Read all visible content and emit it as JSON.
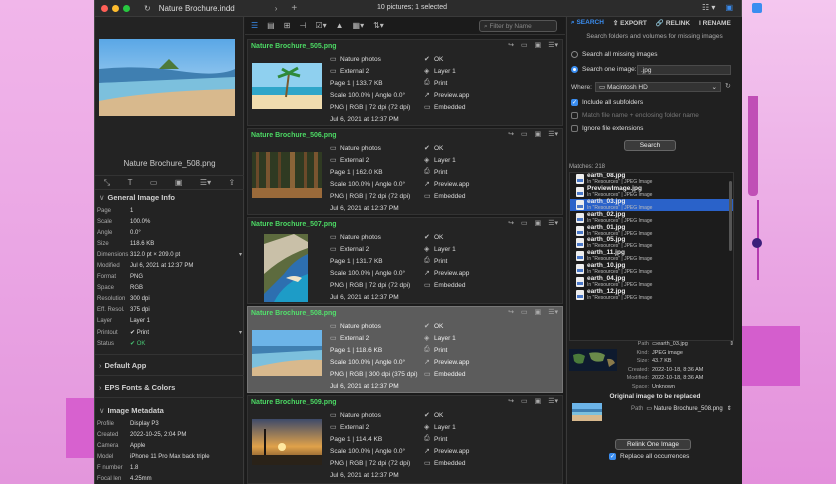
{
  "window": {
    "doc_title": "Nature Brochure.indd",
    "status": "10 pictures; 1 selected"
  },
  "preview": {
    "filename": "Nature Brochure_508.png"
  },
  "general_info": {
    "heading": "General Image Info",
    "rows": [
      {
        "k": "Page",
        "v": "1"
      },
      {
        "k": "Scale",
        "v": "100.0%"
      },
      {
        "k": "Angle",
        "v": "0.0°"
      },
      {
        "k": "Size",
        "v": "118.6 KB"
      },
      {
        "k": "Dimensions",
        "v": "312.0 pt × 209.0 pt"
      },
      {
        "k": "Modified",
        "v": "Jul 6, 2021 at 12:37 PM"
      },
      {
        "k": "Format",
        "v": "PNG"
      },
      {
        "k": "Space",
        "v": "RGB"
      },
      {
        "k": "Resolution",
        "v": "300 dpi"
      },
      {
        "k": "Eff. Resol.",
        "v": "375 dpi"
      },
      {
        "k": "Layer",
        "v": "Layer 1"
      },
      {
        "k": "Printout",
        "v": "✔ Print"
      },
      {
        "k": "Status",
        "v": "✔ OK"
      }
    ]
  },
  "sections": {
    "default_app": "Default App",
    "eps_fonts": "EPS Fonts & Colors",
    "image_metadata": "Image Metadata"
  },
  "metadata": {
    "rows": [
      {
        "k": "Profile",
        "v": "Display P3"
      },
      {
        "k": "Created",
        "v": "2022-10-25, 2:04 PM"
      },
      {
        "k": "Camera",
        "v": "Apple"
      },
      {
        "k": "Model",
        "v": "iPhone 11 Pro Max back triple"
      },
      {
        "k": "F number",
        "v": "1.8"
      },
      {
        "k": "Focal len",
        "v": "4.25mm"
      }
    ]
  },
  "filter": {
    "placeholder": "Filter by Name"
  },
  "cards": [
    {
      "name": "Nature Brochure_505.png",
      "l": [
        "Nature photos",
        "External 2",
        "Page 1 | 133.7 KB",
        "Scale 100.0% | Angle 0.0°",
        "PNG | RGB | 72 dpi (72 dpi)",
        "Jul 6, 2021 at 12:37 PM"
      ],
      "r": [
        "OK",
        "Layer 1",
        "Print",
        "Preview.app",
        "Embedded"
      ]
    },
    {
      "name": "Nature Brochure_506.png",
      "l": [
        "Nature photos",
        "External 2",
        "Page 1 | 162.0 KB",
        "Scale 100.0% | Angle 0.0°",
        "PNG | RGB | 72 dpi (72 dpi)",
        "Jul 6, 2021 at 12:37 PM"
      ],
      "r": [
        "OK",
        "Layer 1",
        "Print",
        "Preview.app",
        "Embedded"
      ]
    },
    {
      "name": "Nature Brochure_507.png",
      "l": [
        "Nature photos",
        "External 2",
        "Page 1 | 131.7 KB",
        "Scale 100.0% | Angle 0.0°",
        "PNG | RGB | 72 dpi (72 dpi)",
        "Jul 6, 2021 at 12:37 PM"
      ],
      "r": [
        "OK",
        "Layer 1",
        "Print",
        "Preview.app",
        "Embedded"
      ]
    },
    {
      "name": "Nature Brochure_508.png",
      "l": [
        "Nature photos",
        "External 2",
        "Page 1 | 118.6 KB",
        "Scale 100.0% | Angle 0.0°",
        "PNG | RGB | 300 dpi (375 dpi)",
        "Jul 6, 2021 at 12:37 PM"
      ],
      "r": [
        "OK",
        "Layer 1",
        "Print",
        "Preview.app",
        "Embedded"
      ]
    },
    {
      "name": "Nature Brochure_509.png",
      "l": [
        "Nature photos",
        "External 2",
        "Page 1 | 114.4 KB",
        "Scale 100.0% | Angle 0.0°",
        "PNG | RGB | 72 dpi (72 dpi)",
        "Jul 6, 2021 at 12:37 PM"
      ],
      "r": [
        "OK",
        "Layer 1",
        "Print",
        "Preview.app",
        "Embedded"
      ]
    }
  ],
  "right": {
    "tabs": [
      "SEARCH",
      "EXPORT",
      "RELINK",
      "RENAME"
    ],
    "hint": "Search folders and volumes for missing images",
    "opt_all": "Search all missing images",
    "opt_one": "Search one image:",
    "ext": ".jpg",
    "where_label": "Where:",
    "where_value": "Macintosh HD",
    "include_sub": "Include all subfolders",
    "match_folder": "Match file name + enclosing folder name",
    "ignore_ext": "Ignore file extensions",
    "search_btn": "Search",
    "matches": "Matches: 218",
    "files": [
      {
        "name": "earth_08.jpg",
        "sub": "In \"Resources\" | JPEG Image"
      },
      {
        "name": "PreviewImage.jpg",
        "sub": "In \"Resources\" | JPEG Image"
      },
      {
        "name": "earth_03.jpg",
        "sub": "In \"Resources\" | JPEG Image"
      },
      {
        "name": "earth_02.jpg",
        "sub": "In \"Resources\" | JPEG Image"
      },
      {
        "name": "earth_01.jpg",
        "sub": "In \"Resources\" | JPEG Image"
      },
      {
        "name": "earth_05.jpg",
        "sub": "In \"Resources\" | JPEG Image"
      },
      {
        "name": "earth_11.jpg",
        "sub": "In \"Resources\" | JPEG Image"
      },
      {
        "name": "earth_10.jpg",
        "sub": "In \"Resources\" | JPEG Image"
      },
      {
        "name": "earth_04.jpg",
        "sub": "In \"Resources\" | JPEG Image"
      },
      {
        "name": "earth_12.jpg",
        "sub": "In \"Resources\" | JPEG Image"
      }
    ],
    "info": [
      {
        "k": "Path",
        "v": "earth_03.jpg"
      },
      {
        "k": "Kind:",
        "v": "JPEG image"
      },
      {
        "k": "Size:",
        "v": "43.7 KB"
      },
      {
        "k": "Created:",
        "v": "2022-10-18, 8:36 AM"
      },
      {
        "k": "Modified:",
        "v": "2022-10-18, 8:36 AM"
      },
      {
        "k": "Space:",
        "v": "Unknown"
      }
    ],
    "orig_head": "Original image to be replaced",
    "orig_path_k": "Path",
    "orig_path_v": "Nature Brochure_508.png",
    "relink_btn": "Relink One Image",
    "replace_all": "Replace all occurrences"
  }
}
